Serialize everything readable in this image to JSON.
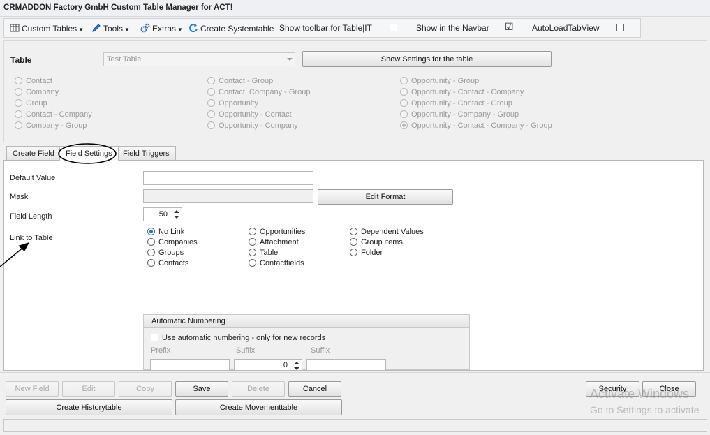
{
  "window": {
    "title": "CRMADDON Factory GmbH Custom Table Manager for ACT!"
  },
  "toolbar": {
    "custom_tables": "Custom Tables",
    "tools": "Tools",
    "extras": "Extras",
    "create_systemtable": "Create Systemtable",
    "show_toolbar": "Show toolbar for Table|IT",
    "show_toolbar_checked": false,
    "show_navbar": "Show in the Navbar",
    "show_navbar_checked": true,
    "autoload": "AutoLoadTabView",
    "autoload_checked": false
  },
  "table_section": {
    "label": "Table",
    "selected_table": "Test Table",
    "show_settings_button": "Show Settings for the table",
    "options_col1": [
      "Contact",
      "Company",
      "Group",
      "Contact - Company",
      "Company - Group"
    ],
    "options_col2": [
      "Contact - Group",
      "Contact, Company - Group",
      "Opportunity",
      "Opportunity - Contact",
      "Opportunity - Company"
    ],
    "options_col3": [
      "Opportunity - Group",
      "Opportunity - Contact - Company",
      "Opportunity - Contact - Group",
      "Opportunity - Company - Group",
      "Opportunity - Contact - Company - Group"
    ],
    "selected_option": "Opportunity - Contact - Company - Group"
  },
  "tabs": [
    {
      "label": "Create Field"
    },
    {
      "label": "Field Settings",
      "active": true
    },
    {
      "label": "Field Triggers"
    }
  ],
  "field_settings": {
    "default_value_label": "Default Value",
    "default_value": "",
    "mask_label": "Mask",
    "mask_value": "",
    "edit_format_button": "Edit Format",
    "field_length_label": "Field Length",
    "field_length": "50",
    "link_to_table_label": "Link to Table",
    "link_col1": [
      "No Link",
      "Companies",
      "Groups",
      "Contacts"
    ],
    "link_col2": [
      "Opportunities",
      "Attachment",
      "Table",
      "Contactfields"
    ],
    "link_col3": [
      "Dependent Values",
      "Group items",
      "Folder"
    ],
    "link_selected": "No Link"
  },
  "automatic_numbering": {
    "title": "Automatic Numbering",
    "use_label": "Use automatic numbering - only for new records",
    "use_checked": false,
    "prefix_label": "Prefix",
    "suffix_label_1": "Suffix",
    "suffix_label_2": "Suffix",
    "prefix_value": "",
    "suffix_number": "0",
    "suffix_value": ""
  },
  "buttons": {
    "new_field": "New Field",
    "edit": "Edit",
    "copy": "Copy",
    "save": "Save",
    "delete": "Delete",
    "cancel": "Cancel",
    "create_historytable": "Create Historytable",
    "create_movementtable": "Create Movementtable",
    "security": "Security",
    "close": "Close"
  },
  "watermark": {
    "line1": "Activate Windows",
    "line2": "Go to Settings to activate"
  },
  "colors": {
    "accent_blue": "#3a6fb0",
    "disabled_text": "#9a9a9a"
  }
}
